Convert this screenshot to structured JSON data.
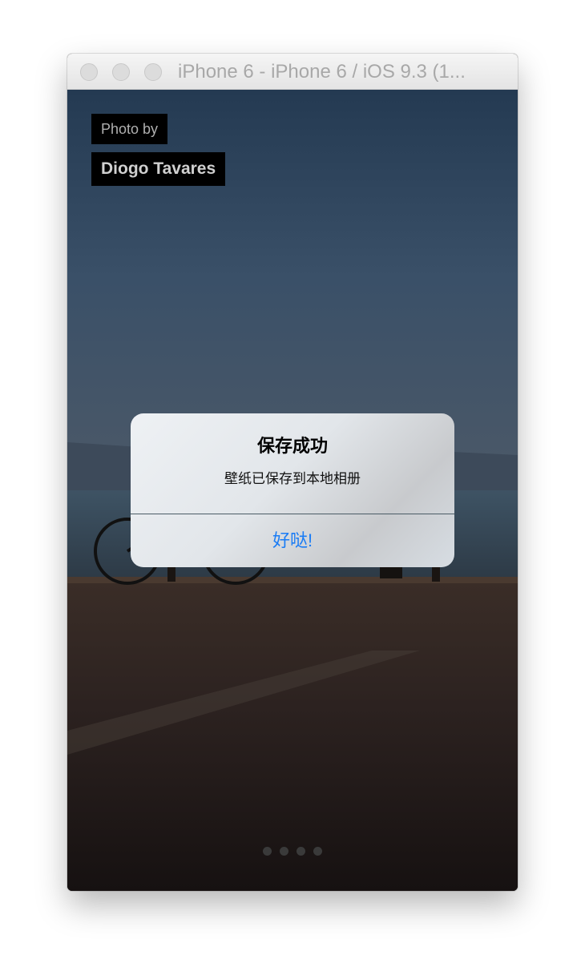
{
  "window": {
    "title": "iPhone 6 - iPhone 6 / iOS 9.3 (1..."
  },
  "photo_credit": {
    "label": "Photo by",
    "author": "Diogo Tavares"
  },
  "alert": {
    "title": "保存成功",
    "message": "壁纸已保存到本地相册",
    "button_label": "好哒!"
  },
  "pager": {
    "page_count": 4,
    "current_page": 1
  },
  "colors": {
    "alert_button": "#1a7cf5",
    "credit_background": "#000000"
  }
}
